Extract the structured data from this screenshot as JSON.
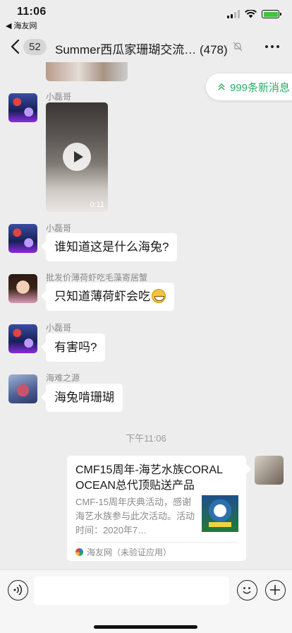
{
  "status": {
    "time": "11:06",
    "back_app": "◀ 海友网"
  },
  "nav": {
    "unread_badge": "52",
    "title": "Summer西瓜家珊瑚交流… (478)"
  },
  "banner": {
    "new_messages": "999条新消息",
    "accent_color": "#2aae67"
  },
  "messages": [
    {
      "sender": "小磊哥",
      "type": "video",
      "duration": "0:11"
    },
    {
      "sender": "小磊哥",
      "type": "text",
      "text": "谁知道这是什么海兔?"
    },
    {
      "sender": "批发价薄荷虾吃毛藻寄居蟹",
      "type": "text",
      "text": "只知道薄荷虾会吃"
    },
    {
      "sender": "小磊哥",
      "type": "text",
      "text": "有害吗?"
    },
    {
      "sender": "海难之源",
      "type": "text",
      "text": "海兔啃珊瑚"
    }
  ],
  "timestamp": "下午11:06",
  "card": {
    "title": "CMF15周年-海艺水族CORAL OCEAN总代顶贴送产品",
    "description": "CMF-15周年庆典活动，感谢海艺水族参与此次活动。活动时间：2020年7…",
    "source": "海友网（未验证应用）"
  },
  "input": {
    "placeholder": ""
  }
}
